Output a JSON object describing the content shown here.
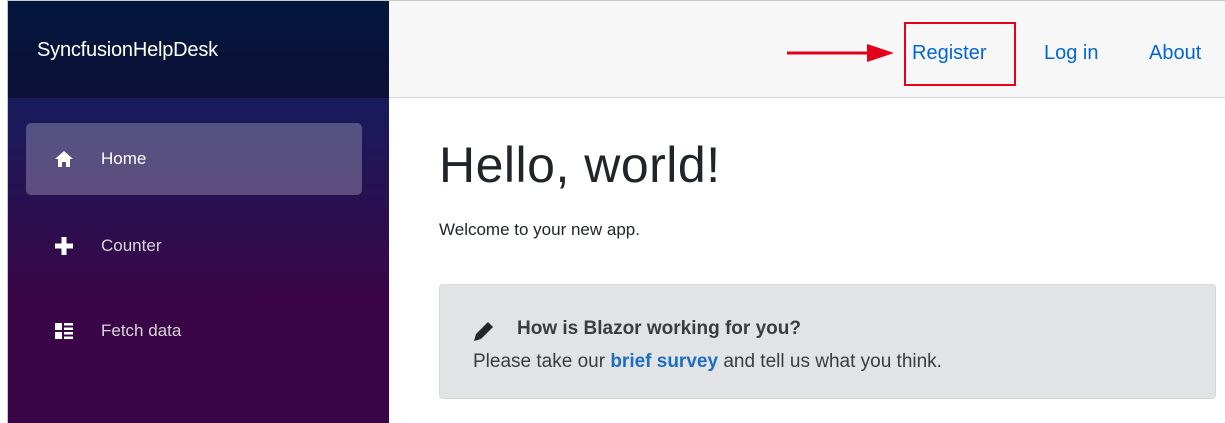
{
  "app": {
    "brand": "SyncfusionHelpDesk"
  },
  "sidebar": {
    "items": [
      {
        "label": "Home",
        "icon": "home-icon",
        "active": true
      },
      {
        "label": "Counter",
        "icon": "plus-icon",
        "active": false
      },
      {
        "label": "Fetch data",
        "icon": "list-icon",
        "active": false
      }
    ]
  },
  "topbar": {
    "register_label": "Register",
    "login_label": "Log in",
    "about_label": "About"
  },
  "main": {
    "title": "Hello, world!",
    "welcome": "Welcome to your new app.",
    "survey": {
      "title": "How is Blazor working for you?",
      "text_before": "Please take our",
      "link_text": "brief survey",
      "text_after": "and tell us what you think."
    }
  },
  "colors": {
    "link": "#0366d6",
    "highlight": "#e4001b",
    "sidebar_top": "#052767",
    "sidebar_bottom": "#3a0647"
  }
}
